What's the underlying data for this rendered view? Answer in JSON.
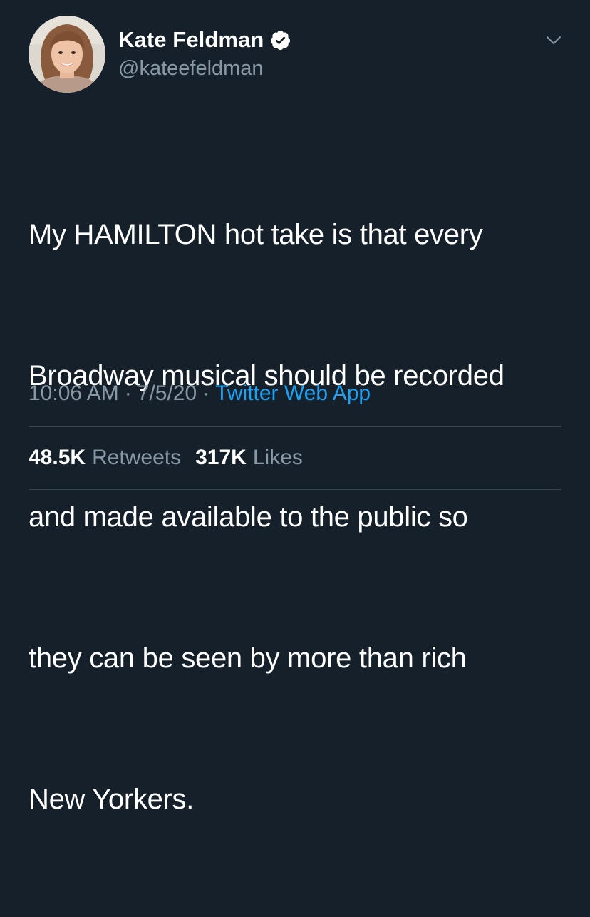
{
  "author": {
    "display_name": "Kate Feldman",
    "handle": "@kateefeldman",
    "verified": true,
    "avatar_icon": "profile-photo"
  },
  "tweet": {
    "text_lines": [
      "My HAMILTON hot take is that every",
      "Broadway musical should be recorded",
      "and made available to the public so",
      "they can be seen by more than rich",
      "New Yorkers."
    ]
  },
  "meta": {
    "time": "10:06 AM",
    "separator": "·",
    "date": "7/5/20",
    "source": "Twitter Web App"
  },
  "stats": {
    "retweets_count": "48.5K",
    "retweets_label": "Retweets",
    "likes_count": "317K",
    "likes_label": "Likes"
  },
  "icons": {
    "verified": "verified-badge-icon",
    "menu": "chevron-down-icon"
  },
  "colors": {
    "background": "#15202b",
    "primary_text": "#ffffff",
    "secondary_text": "#8899a6",
    "link": "#1da1f2",
    "divider": "#38444d"
  }
}
